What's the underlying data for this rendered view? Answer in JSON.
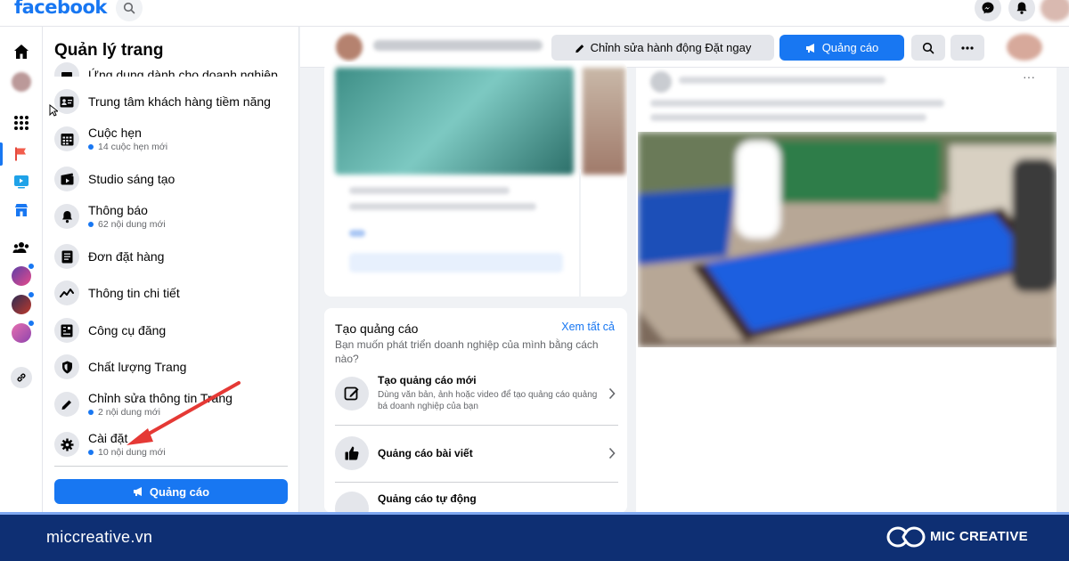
{
  "topbar": {
    "logo": "facebook"
  },
  "sidebar": {
    "title": "Quản lý trang",
    "items": [
      {
        "label": "Ứng dụng dành cho doanh nghiệp",
        "sub": ""
      },
      {
        "label": "Trung tâm khách hàng tiềm năng",
        "sub": ""
      },
      {
        "label": "Cuộc hẹn",
        "sub": "14 cuộc hẹn mới"
      },
      {
        "label": "Studio sáng tạo",
        "sub": ""
      },
      {
        "label": "Thông báo",
        "sub": "62 nội dung mới"
      },
      {
        "label": "Đơn đặt hàng",
        "sub": ""
      },
      {
        "label": "Thông tin chi tiết",
        "sub": ""
      },
      {
        "label": "Công cụ đăng",
        "sub": ""
      },
      {
        "label": "Chất lượng Trang",
        "sub": ""
      },
      {
        "label": "Chỉnh sửa thông tin Trang",
        "sub": "2 nội dung mới"
      },
      {
        "label": "Cài đặt",
        "sub": "10 nội dung mới"
      }
    ],
    "ad_button": "Quảng cáo"
  },
  "header": {
    "edit_action": "Chỉnh sửa hành động Đặt ngay",
    "ad_button": "Quảng cáo"
  },
  "create_ad": {
    "title": "Tạo quảng cáo",
    "see_all": "Xem tất cả",
    "description": "Bạn muốn phát triển doanh nghiệp của mình bằng cách nào?",
    "options": [
      {
        "title": "Tạo quảng cáo mới",
        "desc": "Dùng văn bản, ảnh hoặc video để tạo quảng cáo quảng bá doanh nghiệp của bạn"
      },
      {
        "title": "Quảng cáo bài viết",
        "desc": ""
      },
      {
        "title": "Quảng cáo tự động",
        "desc": ""
      }
    ]
  },
  "feed": {
    "more": "···"
  },
  "footer": {
    "website": "miccreative.vn",
    "brand": "MIC CREATIVE"
  },
  "colors": {
    "fb_blue": "#1877f2",
    "footer_bg": "#0e2f73",
    "arrow_red": "#e53935"
  }
}
